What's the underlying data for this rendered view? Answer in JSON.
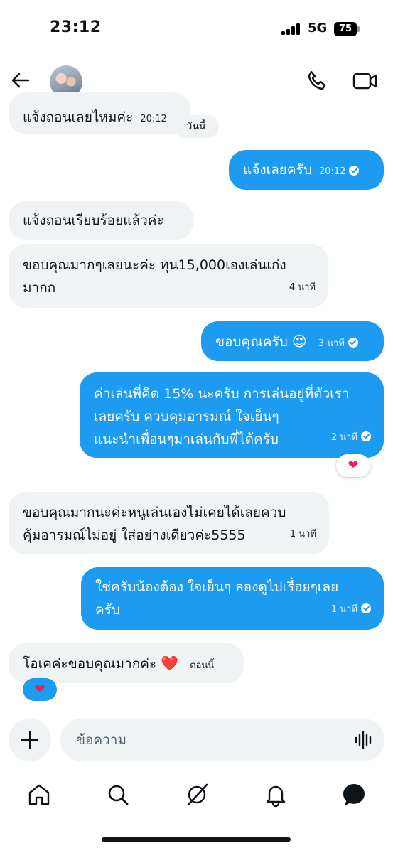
{
  "status_bar": {
    "time": "23:12",
    "network": "5G",
    "battery": "75"
  },
  "header": {
    "avatar_icon": "profile-photo",
    "call_icon": "phone-icon",
    "video_icon": "video-camera-icon"
  },
  "day_divider": "วันนี้",
  "messages": [
    {
      "direction": "incoming",
      "text": "แจ้งถอนเลยไหมค่ะ",
      "time": "20:12"
    },
    {
      "direction": "outgoing",
      "text": "แจ้งเลยครับ",
      "time": "20:12"
    },
    {
      "direction": "incoming",
      "text": "แจ้งถอนเรียบร้อยแล้วค่ะ",
      "time": ""
    },
    {
      "direction": "incoming",
      "text_lines": [
        "ขอบคุณมากๆเลยนะค่ะ ทุน15,000เองเล่นเก่ง",
        "มากก"
      ],
      "time": "4 นาที"
    },
    {
      "direction": "outgoing",
      "text": "ขอบคุณครับ",
      "emoji": "😍",
      "time": "3 นาที"
    },
    {
      "direction": "outgoing",
      "text_lines": [
        "ค่าเล่นพี่คิด 15% นะครับ การเล่นอยู่ที่ตัวเรา",
        "เลยครับ ควบคุมอารมณ์ ใจเย็นๆ",
        "แนะนำเพื่อนๆมาเล่นกับพี่ได้ครับ"
      ],
      "time": "2 นาที",
      "reaction": "❤"
    },
    {
      "direction": "incoming",
      "text_lines": [
        "ขอบคุณมากนะค่ะหนูเล่นเองไม่เคยได้เลยควบ",
        "คุ้มอารมณ์ไม่อยู่ ใส่อย่างเดียวค่ะ5555"
      ],
      "time": "1 นาที"
    },
    {
      "direction": "outgoing",
      "text_lines": [
        "ใช่ครับน้องต้อง ใจเย็นๆ ลองดูไปเรื่อยๆเลย",
        "ครับ"
      ],
      "time": "1 นาที"
    },
    {
      "direction": "incoming",
      "text": "โอเคค่ะขอบคุณมากค่ะ",
      "emoji": "❤️",
      "time": "ตอนนี้",
      "reaction": "❤"
    }
  ],
  "composer": {
    "placeholder": "ข้อความ",
    "value": ""
  },
  "nav": [
    "home-icon",
    "search-icon",
    "grok-icon",
    "notifications-bell-icon",
    "messages-icon"
  ],
  "colors": {
    "outgoing_bubble": "#1d9bf0",
    "incoming_bubble": "#eff3f4",
    "reaction_heart": "#e0245e"
  }
}
